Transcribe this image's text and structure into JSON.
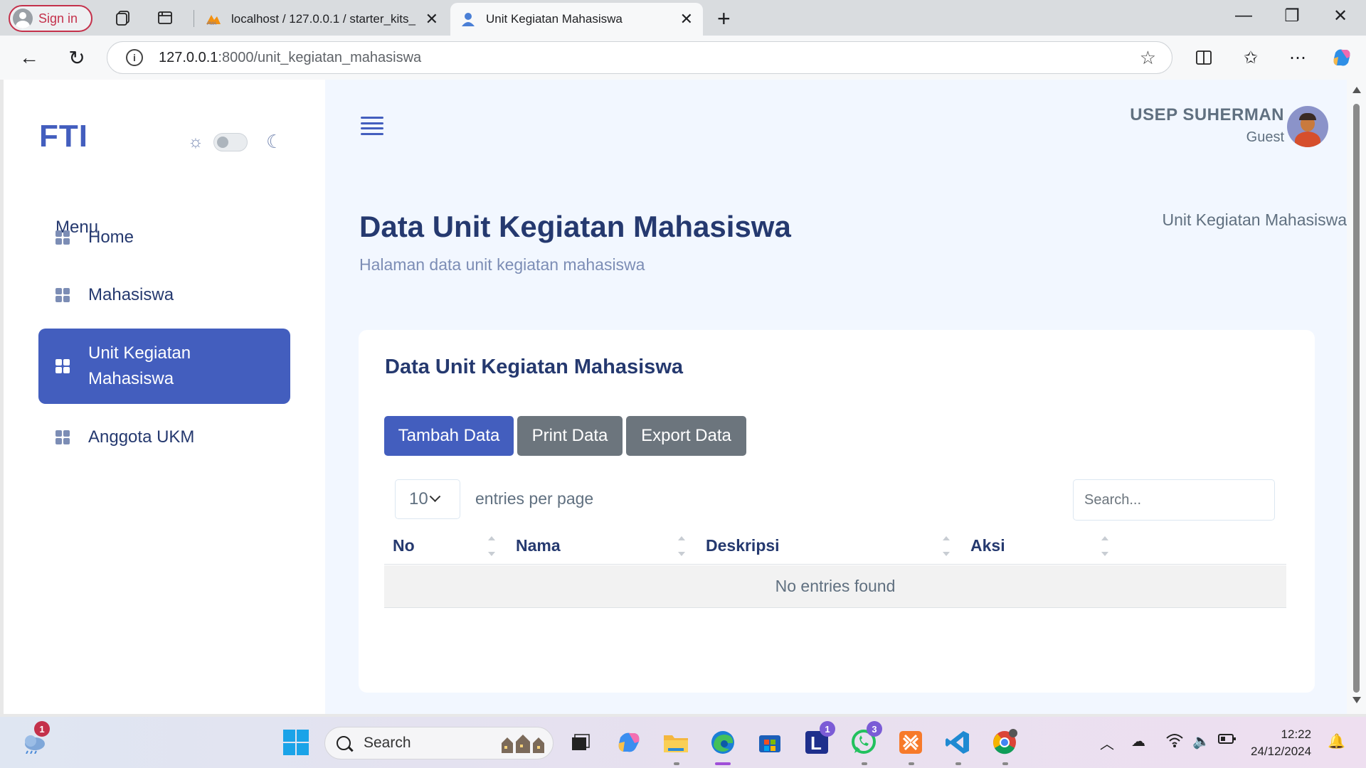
{
  "browser": {
    "signin_label": "Sign in",
    "tabs": [
      {
        "title": "localhost / 127.0.0.1 / starter_kits_",
        "favicon": "pma-icon"
      },
      {
        "title": "Unit Kegiatan Mahasiswa",
        "favicon": "user-icon"
      }
    ],
    "url_host": "127.0.0.1",
    "url_path": ":8000/unit_kegiatan_mahasiswa"
  },
  "sidebar": {
    "logo": "FTI",
    "menu_title": "Menu",
    "items": [
      {
        "label": "Home",
        "active": false
      },
      {
        "label": "Mahasiswa",
        "active": false
      },
      {
        "label": "Unit Kegiatan Mahasiswa",
        "active": true
      },
      {
        "label": "Anggota UKM",
        "active": false
      }
    ]
  },
  "header": {
    "user_name": "USEP SUHERMAN",
    "user_role": "Guest"
  },
  "page": {
    "title": "Data Unit Kegiatan Mahasiswa",
    "subtitle": "Halaman data unit kegiatan mahasiswa",
    "breadcrumb": "Unit Kegiatan Mahasiswa"
  },
  "card": {
    "title": "Data Unit Kegiatan Mahasiswa",
    "buttons": {
      "add": "Tambah Data",
      "print": "Print Data",
      "export": "Export Data"
    },
    "per_page_value": "10",
    "per_page_label": "entries per page",
    "search_placeholder": "Search...",
    "columns": [
      "No",
      "Nama",
      "Deskripsi",
      "Aksi"
    ],
    "empty_message": "No entries found"
  },
  "taskbar": {
    "search_label": "Search",
    "time": "12:22",
    "date": "24/12/2024",
    "badges": {
      "weather": "1",
      "teams": "1",
      "whatsapp": "3"
    }
  },
  "colors": {
    "primary": "#435ebe",
    "secondary": "#6c757d",
    "page_bg": "#f2f7ff",
    "heading": "#25396f",
    "muted": "#7c8db5"
  }
}
